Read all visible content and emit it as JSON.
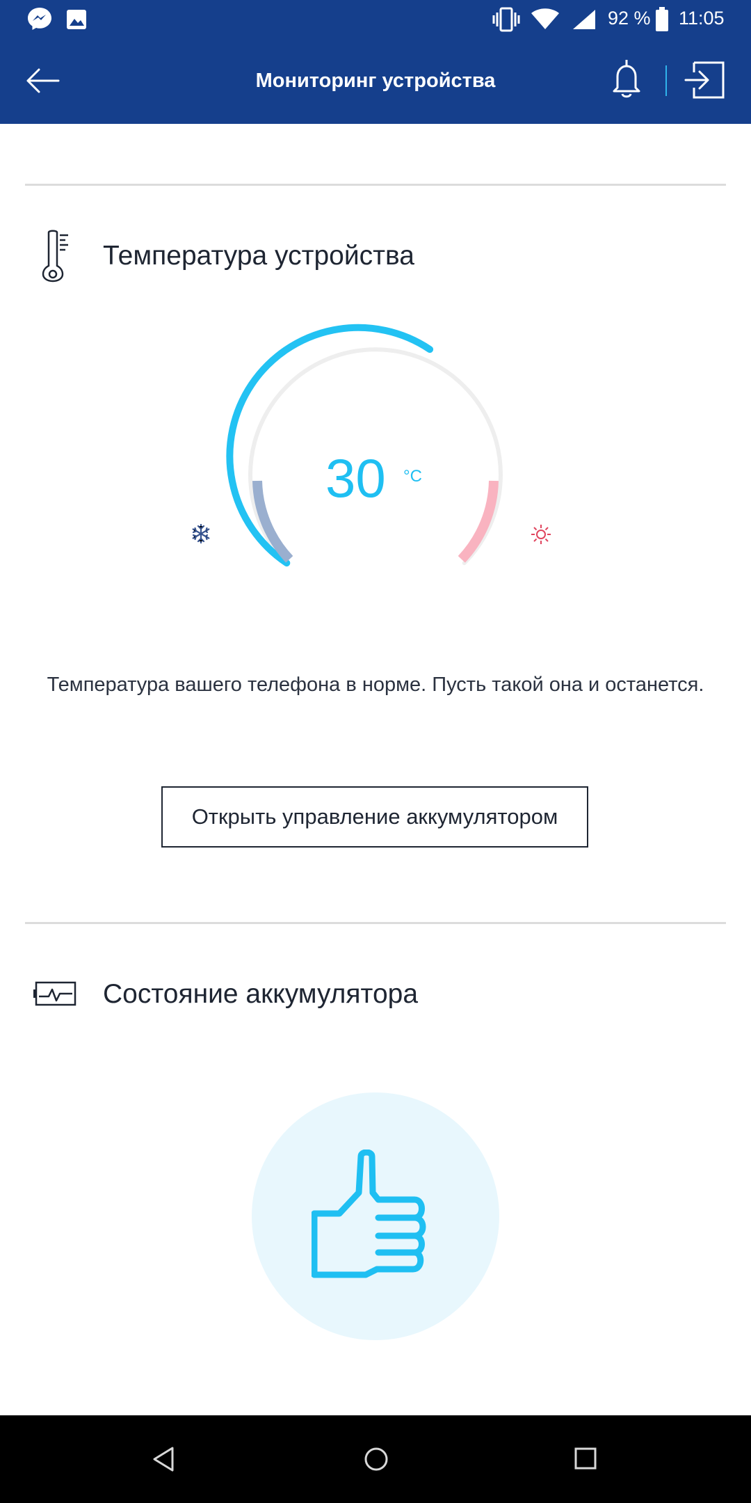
{
  "status_bar": {
    "battery_percent": "92 %",
    "time": "11:05",
    "notification_icons": [
      "messenger-icon",
      "image-icon"
    ],
    "system_icons": [
      "vibrate-icon",
      "wifi-icon",
      "signal-icon",
      "battery-icon"
    ]
  },
  "app_bar": {
    "title": "Мониторинг устройства",
    "icons": [
      "back-arrow-icon",
      "bell-icon",
      "exit-icon"
    ],
    "accent_color": "#153f8c"
  },
  "temperature_section": {
    "title": "Температура устройства",
    "icon": "thermometer-icon",
    "value": "30",
    "unit": "°C",
    "status_message": "Температура вашего телефона в норме. Пусть такой она и останется.",
    "button_label": "Открыть управление аккумулятором",
    "cold_icon": "snowflake-icon",
    "hot_icon": "sun-icon",
    "gauge_level": 0.5,
    "colors": {
      "value": "#1fbff2",
      "cold": "#9aafcf",
      "hot": "#f9b3c0",
      "track": "#eeeeee"
    }
  },
  "battery_section": {
    "title": "Состояние аккумулятора",
    "icon": "battery-pulse-icon",
    "status_icon": "thumbs-up-icon"
  },
  "nav_bar": {
    "buttons": [
      "back-nav-icon",
      "home-nav-icon",
      "recents-nav-icon"
    ]
  }
}
